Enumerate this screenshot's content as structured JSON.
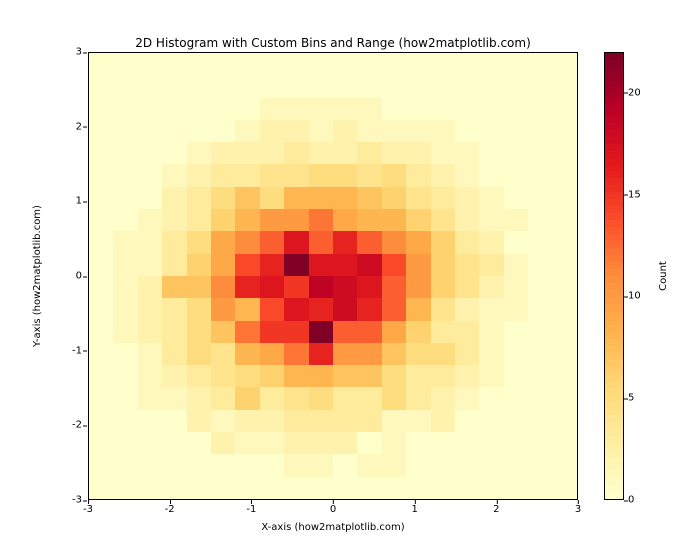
{
  "chart_data": {
    "type": "heatmap",
    "title": "2D Histogram with Custom Bins and Range (how2matplotlib.com)",
    "xlabel": "X-axis (how2matplotlib.com)",
    "ylabel": "Y-axis (how2matplotlib.com)",
    "cbar_label": "Count",
    "xlim": [
      -3,
      3
    ],
    "ylim": [
      -3,
      3
    ],
    "vmin": 0,
    "vmax": 22,
    "xticks": [
      -3,
      -2,
      -1,
      0,
      1,
      2,
      3
    ],
    "yticks": [
      -3,
      -2,
      -1,
      0,
      1,
      2,
      3
    ],
    "cbar_ticks": [
      0,
      5,
      10,
      15,
      20
    ],
    "nbins_x": 20,
    "nbins_y": 20,
    "cmap": "YlOrRd",
    "counts": [
      [
        0,
        0,
        0,
        0,
        0,
        0,
        0,
        0,
        0,
        0,
        0,
        0,
        0,
        0,
        0,
        0,
        0,
        0,
        0,
        0
      ],
      [
        0,
        0,
        0,
        0,
        0,
        0,
        0,
        0,
        1,
        1,
        0,
        1,
        1,
        0,
        0,
        0,
        0,
        0,
        0,
        0
      ],
      [
        0,
        0,
        0,
        0,
        0,
        2,
        1,
        1,
        2,
        2,
        2,
        0,
        1,
        0,
        0,
        0,
        0,
        0,
        0,
        0
      ],
      [
        0,
        0,
        0,
        0,
        2,
        1,
        2,
        2,
        3,
        3,
        3,
        3,
        1,
        1,
        2,
        0,
        0,
        0,
        0,
        0
      ],
      [
        0,
        0,
        1,
        1,
        2,
        3,
        6,
        3,
        4,
        5,
        3,
        3,
        5,
        3,
        2,
        1,
        0,
        0,
        0,
        0
      ],
      [
        0,
        0,
        1,
        2,
        3,
        4,
        5,
        6,
        8,
        8,
        7,
        7,
        5,
        3,
        3,
        2,
        1,
        0,
        0,
        0
      ],
      [
        0,
        0,
        1,
        3,
        5,
        4,
        8,
        9,
        12,
        16,
        10,
        10,
        7,
        5,
        5,
        3,
        1,
        0,
        0,
        0
      ],
      [
        0,
        1,
        2,
        3,
        5,
        7,
        12,
        15,
        15,
        22,
        13,
        13,
        9,
        6,
        3,
        3,
        1,
        0,
        0,
        0
      ],
      [
        0,
        1,
        2,
        3,
        5,
        10,
        8,
        14,
        17,
        16,
        18,
        16,
        13,
        8,
        4,
        2,
        1,
        1,
        0,
        0
      ],
      [
        0,
        1,
        2,
        7,
        7,
        11,
        16,
        17,
        15,
        19,
        18,
        17,
        13,
        10,
        6,
        4,
        2,
        1,
        0,
        0
      ],
      [
        0,
        1,
        1,
        3,
        6,
        9,
        14,
        16,
        22,
        17,
        17,
        18,
        14,
        10,
        6,
        4,
        3,
        1,
        0,
        0
      ],
      [
        0,
        1,
        1,
        3,
        5,
        9,
        11,
        13,
        17,
        13,
        16,
        13,
        11,
        9,
        6,
        3,
        2,
        0,
        0,
        0
      ],
      [
        0,
        0,
        1,
        2,
        3,
        6,
        8,
        10,
        10,
        12,
        9,
        8,
        8,
        6,
        4,
        2,
        1,
        1,
        0,
        0
      ],
      [
        0,
        0,
        0,
        2,
        3,
        5,
        7,
        5,
        8,
        8,
        8,
        7,
        6,
        4,
        3,
        2,
        1,
        0,
        0,
        0
      ],
      [
        0,
        0,
        0,
        1,
        2,
        3,
        3,
        4,
        4,
        5,
        5,
        4,
        5,
        3,
        2,
        1,
        0,
        0,
        0,
        0
      ],
      [
        0,
        0,
        0,
        0,
        1,
        2,
        2,
        2,
        3,
        2,
        2,
        3,
        2,
        2,
        1,
        1,
        0,
        0,
        0,
        0
      ],
      [
        0,
        0,
        0,
        0,
        0,
        0,
        1,
        2,
        2,
        1,
        2,
        1,
        1,
        1,
        1,
        0,
        0,
        0,
        0,
        0
      ],
      [
        0,
        0,
        0,
        0,
        0,
        0,
        0,
        1,
        1,
        1,
        1,
        1,
        0,
        0,
        0,
        0,
        0,
        0,
        0,
        0
      ],
      [
        0,
        0,
        0,
        0,
        0,
        0,
        0,
        0,
        0,
        0,
        0,
        0,
        0,
        0,
        0,
        0,
        0,
        0,
        0,
        0
      ],
      [
        0,
        0,
        0,
        0,
        0,
        0,
        0,
        0,
        0,
        0,
        0,
        0,
        0,
        0,
        0,
        0,
        0,
        0,
        0,
        0
      ]
    ]
  }
}
